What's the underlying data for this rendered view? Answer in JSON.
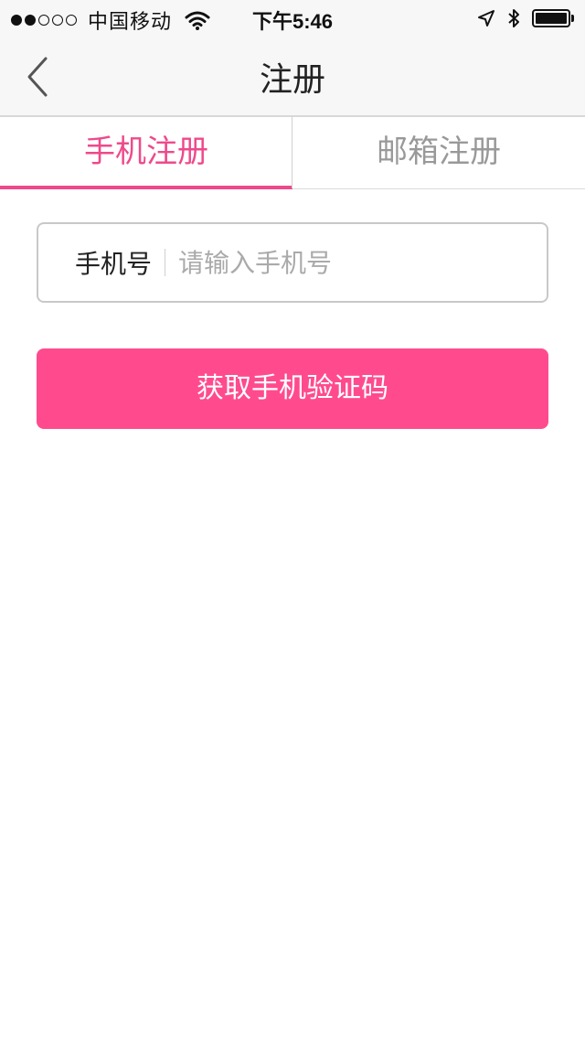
{
  "status_bar": {
    "carrier": "中国移动",
    "time": "下午5:46",
    "signal_strength": 2,
    "battery_level": 1.0
  },
  "nav": {
    "title": "注册",
    "back_icon": "chevron-left-icon"
  },
  "tabs": [
    {
      "label": "手机注册",
      "active": true
    },
    {
      "label": "邮箱注册",
      "active": false
    }
  ],
  "form": {
    "phone_label": "手机号",
    "phone_placeholder": "请输入手机号",
    "phone_value": ""
  },
  "submit_button": {
    "label": "获取手机验证码"
  },
  "colors": {
    "accent": "#ee4a8b",
    "button": "#ff4b8e",
    "nav_background": "#f7f7f8"
  }
}
